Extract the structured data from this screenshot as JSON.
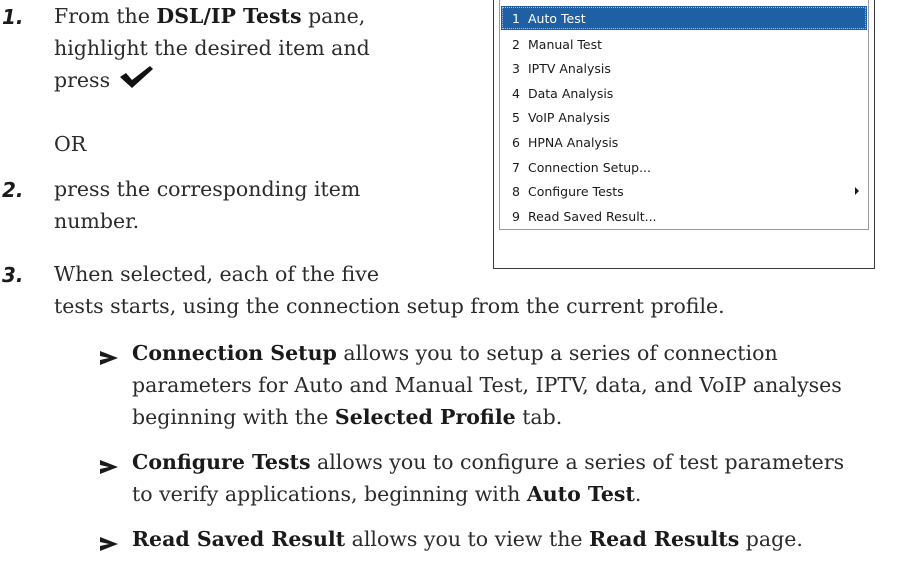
{
  "steps": [
    {
      "number": "1.",
      "line1_pre": "From the ",
      "line1_bold": "DSL/IP Tests",
      "line1_post": " pane,",
      "line2": "highlight the desired item and",
      "line3": "press"
    },
    {
      "or_text": "OR"
    },
    {
      "number": "2.",
      "line1": "press the corresponding item",
      "line2": "number."
    },
    {
      "number": "3.",
      "line1": "When selected, each of the five",
      "line2": "tests starts, using the connection setup from the current profile."
    }
  ],
  "menu": {
    "items": [
      {
        "num": "1",
        "label": "Auto Test",
        "selected": true
      },
      {
        "num": "2",
        "label": "Manual Test"
      },
      {
        "num": "3",
        "label": "IPTV Analysis"
      },
      {
        "num": "4",
        "label": "Data Analysis"
      },
      {
        "num": "5",
        "label": "VoIP Analysis"
      },
      {
        "num": "6",
        "label": "HPNA Analysis"
      },
      {
        "num": "7",
        "label": "Connection Setup..."
      },
      {
        "num": "8",
        "label": "Configure Tests",
        "submenu": true
      },
      {
        "num": "9",
        "label": "Read Saved Result..."
      }
    ]
  },
  "bullets": [
    {
      "bold": "Connection Setup",
      "t1": " allows you to setup a series of connection",
      "t2": "parameters for Auto and Manual Test, IPTV, data, and VoIP analyses",
      "t3": "beginning with the ",
      "bold2": "Selected Profile",
      "t4": " tab."
    },
    {
      "bold": "Configure Tests",
      "t1": " allows you to configure a series of test parameters",
      "t2": "to verify applications, beginning with ",
      "bold2": "Auto Test",
      "t3": "."
    },
    {
      "bold": "Read Saved Result",
      "t1": " allows you to view the ",
      "bold2": "Read Results",
      "t2": " page."
    }
  ]
}
